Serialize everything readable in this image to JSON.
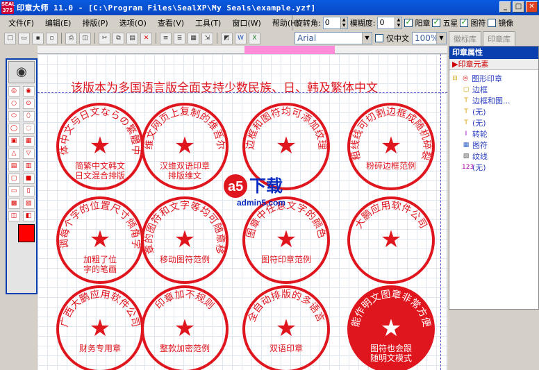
{
  "window": {
    "title": "印章大师 11.0 - [C:\\Program Files\\SealXP\\My Seals\\example.yzf]",
    "icon_text": "SEAL 375"
  },
  "menu": [
    "文件(F)",
    "编辑(E)",
    "排版(P)",
    "选项(O)",
    "查看(V)",
    "工具(T)",
    "窗口(W)",
    "帮助(H)"
  ],
  "rotation": {
    "rot_label": "旋转角:",
    "rot_value": "0",
    "blur_label": "模糊度:",
    "blur_value": "0",
    "yang_label": "阳章",
    "star_label": "五星",
    "figure_label": "图符",
    "mirror_label": "镜像"
  },
  "font": {
    "name": "Arial",
    "only_cn_label": "仅中文",
    "zoom": "100%"
  },
  "tabs": [
    "徽标库",
    "印章库"
  ],
  "canvas": {
    "caption": "该版本为多国语言版全面支持少数民族、日、韩及繁体中文"
  },
  "seals": [
    {
      "ring": "简体中文与日文ならの繁體中文",
      "center": "简繁中文韩文\n日文混合排版"
    },
    {
      "ring": "维文网页上复制的维吾尔",
      "center": "汉维双语印章\n排版维文"
    },
    {
      "ring": "边框和图符均可添加纹理",
      "center": ""
    },
    {
      "ring": "粗线线可切割边框成随机碎裂",
      "center": "粉碎边框范例"
    },
    {
      "ring": "能微调每个字的位置尺寸倾角字间距",
      "center": "加粗了位\n字的笔画"
    },
    {
      "ring": "印章的图符和文字等均可随意移动",
      "center": "移动图符范例"
    },
    {
      "ring": "图章中任意文字的颜色",
      "center": "图符印章范例"
    },
    {
      "ring": "大鹏应用软件公司",
      "center": ""
    },
    {
      "ring": "广西大鹏应用软件公司",
      "center": "财务专用章"
    },
    {
      "ring": "印章加不规则",
      "center": "整款加密范例"
    },
    {
      "ring": "全自动排版的多语言",
      "center": "双语印章"
    },
    {
      "ring": "能作明文图章非常方便",
      "center": "图符也会跟\n随明文模式"
    }
  ],
  "watermark": {
    "brand": "a5下载",
    "site": "admin5.com"
  },
  "properties": {
    "title": "印章属性",
    "sub": "印章元素",
    "tree": [
      "图形印章",
      "边框",
      "边框和图...",
      "(无)",
      "(无)",
      "转轮",
      "图符",
      "纹线",
      "(无)"
    ]
  },
  "colors": {
    "seal_red": "#e0161f",
    "title_blue": "#0a5be0"
  }
}
